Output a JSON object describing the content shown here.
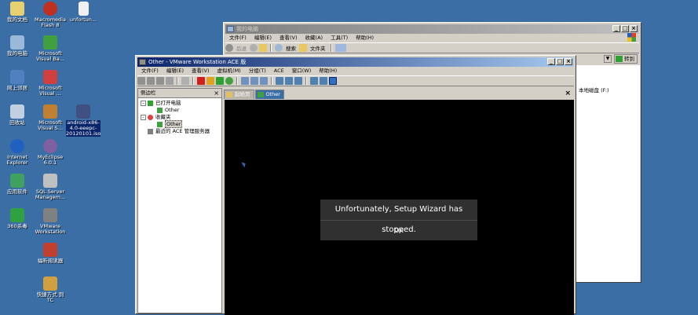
{
  "desktop": {
    "icons": [
      {
        "label": "我的文档",
        "color": "#e8d070"
      },
      {
        "label": "Macromedia Flash 8",
        "color": "#c03020"
      },
      {
        "label": "unfortun...",
        "color": "#f0f0f0"
      },
      {
        "label": "我的电脑",
        "color": "#9ab8d8"
      },
      {
        "label": "Microsoft Visual Ba...",
        "color": "#40a040"
      },
      {
        "label": "网上邻居",
        "color": "#5080c0"
      },
      {
        "label": "Microsoft Visual ...",
        "color": "#d04040"
      },
      {
        "label": "回收站",
        "color": "#c0d0e0"
      },
      {
        "label": "Microsoft Visual S...",
        "color": "#c08030"
      },
      {
        "label": "android-x86-4.0-eeepc-20120101.iso",
        "color": "#405080"
      },
      {
        "label": "Internet Explorer",
        "color": "#2060c0"
      },
      {
        "label": "MyEclipse 6.0.1",
        "color": "#8060a0"
      },
      {
        "label": "应用软件",
        "color": "#40a060"
      },
      {
        "label": "SQL Server Managem...",
        "color": "#c0c0c0"
      },
      {
        "label": "360杀毒",
        "color": "#30a040"
      },
      {
        "label": "VMware Workstation",
        "color": "#808080"
      },
      {
        "label": "福昕阅读器",
        "color": "#c04030"
      },
      {
        "label": "快捷方式 到 TC",
        "color": "#d0a040"
      }
    ]
  },
  "explorer": {
    "title": "我的电脑",
    "menus": [
      "文件(F)",
      "编辑(E)",
      "查看(V)",
      "收藏(A)",
      "工具(T)",
      "帮助(H)"
    ],
    "toolbar": {
      "back": "后退",
      "search": "搜索",
      "folders": "文件夹"
    },
    "go_label": "转到",
    "visible_item": "本地磁盘 (F:)"
  },
  "vmware": {
    "title": "Other - VMware Workstation ACE 版",
    "menus": [
      "文件(F)",
      "编辑(E)",
      "查看(V)",
      "虚拟机(M)",
      "分组(T)",
      "ACE",
      "窗口(W)",
      "帮助(H)"
    ],
    "sidebar": {
      "header": "侧边栏",
      "tree": [
        {
          "label": "已打开电脑",
          "level": 0,
          "icon": "computer-icon"
        },
        {
          "label": "Other",
          "level": 1,
          "icon": "vm-icon"
        },
        {
          "label": "收藏夹",
          "level": 0,
          "icon": "favorites-icon"
        },
        {
          "label": "Other",
          "level": 1,
          "icon": "vm-icon",
          "selected": true
        },
        {
          "label": "最近的 ACE 管理服务器",
          "level": 0,
          "icon": "server-icon"
        }
      ]
    },
    "tabs": [
      {
        "label": "起始页",
        "active": false
      },
      {
        "label": "Other",
        "active": true
      }
    ],
    "dialog": {
      "message": "Unfortunately, Setup Wizard has stopped.",
      "ok_label": "OK"
    }
  }
}
